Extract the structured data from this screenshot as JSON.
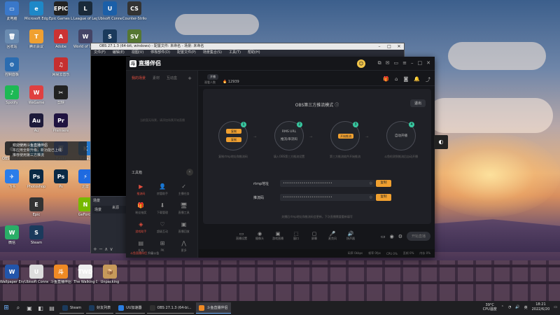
{
  "desktop": {
    "icons": [
      {
        "label": "此电脑",
        "color": "#3a78c9",
        "glyph": "▭"
      },
      {
        "label": "Microsoft Edge",
        "color": "#1e88c8",
        "glyph": "e"
      },
      {
        "label": "Epic Games Launcher",
        "color": "#222222",
        "glyph": "EPIC"
      },
      {
        "label": "League of Legends",
        "color": "#1a2a3a",
        "glyph": "L"
      },
      {
        "label": "Ubisoft Connect",
        "color": "#1b5fa8",
        "glyph": "U"
      },
      {
        "label": "Counter-Strike",
        "color": "#333333",
        "glyph": "CS"
      },
      {
        "label": "回收站",
        "color": "#6a8bb0",
        "glyph": "🗑"
      },
      {
        "label": "腾讯会议",
        "color": "#f0a030",
        "glyph": "T"
      },
      {
        "label": "Adobe",
        "color": "#cc3333",
        "glyph": "A"
      },
      {
        "label": "World of Warships",
        "color": "#444466",
        "glyph": "W"
      },
      {
        "label": "Steam",
        "color": "#1b3a5c",
        "glyph": "S"
      },
      {
        "label": "Stardew Valley",
        "color": "#557733",
        "glyph": "SV"
      },
      {
        "label": "控制面板",
        "color": "#2b6cb0",
        "glyph": "⚙"
      },
      {
        "label": "Au",
        "color": "#1d1a3a",
        "glyph": "Au"
      },
      {
        "label": "剪映",
        "color": "#222222",
        "glyph": "✂"
      },
      {
        "label": "OBS Studio",
        "color": "#303030",
        "glyph": "●"
      },
      {
        "label": "Photoshop",
        "color": "#0a2a45",
        "glyph": "Ps"
      },
      {
        "label": "Premiere",
        "color": "#1f1240",
        "glyph": "Pr"
      },
      {
        "label": "Spotify",
        "color": "#1db954",
        "glyph": "♪"
      },
      {
        "label": "WeGame",
        "color": "#e04040",
        "glyph": "W"
      },
      {
        "label": "网易云音乐",
        "color": "#c62f2f",
        "glyph": "♫"
      },
      {
        "label": "QQ",
        "color": "#1296db",
        "glyph": "Q"
      },
      {
        "label": "Baidu",
        "color": "#2a5bd7",
        "glyph": "百"
      },
      {
        "label": "Kakao",
        "color": "#2277cc",
        "glyph": "K"
      },
      {
        "label": "飞书",
        "color": "#2b7de9",
        "glyph": "✈"
      },
      {
        "label": "Ps",
        "color": "#0a2a45",
        "glyph": "Ps"
      },
      {
        "label": "迅雷",
        "color": "#1e6ae0",
        "glyph": "⚡"
      },
      {
        "label": "Epic",
        "color": "#333333",
        "glyph": "E"
      },
      {
        "label": "微信",
        "color": "#2aae67",
        "glyph": "W"
      },
      {
        "label": "Steam",
        "color": "#1b3a5c",
        "glyph": "S"
      },
      {
        "label": "GeForce",
        "color": "#76b900",
        "glyph": "N"
      },
      {
        "label": "Wallpaper Engine",
        "color": "#2255aa",
        "glyph": "W"
      },
      {
        "label": "Ubisoft Connect",
        "color": "#dddddd",
        "glyph": "U"
      },
      {
        "label": "斗鱼直播伴侣",
        "color": "#f08a24",
        "glyph": "斗"
      },
      {
        "label": "The Walking Dead The",
        "color": "#eeeeee",
        "glyph": "TWD"
      },
      {
        "label": "Unpacking",
        "color": "#c79a5a",
        "glyph": "📦"
      }
    ]
  },
  "tooltip": {
    "line1": "欢迎使用斗鱼直播伴侣",
    "line2": "本应用全新升级，新功能已上线",
    "line3": "推荐使用第三方推流"
  },
  "obs": {
    "title": "OBS 27.1.3 (64-bit, windows) - 配置文件: 未命名 - 场景: 未命名",
    "menu": [
      "文件(F)",
      "编辑(E)",
      "视图(V)",
      "停靠部件(D)",
      "配置文件(P)",
      "场景集合(S)",
      "工具(T)",
      "帮助(H)"
    ],
    "scenes_header": "场景",
    "scene_row": "场景",
    "source_tag": "来源",
    "tool_glyphs": "+ − ∧ ∨"
  },
  "zb": {
    "logo": "直播伴侣",
    "logo_badge": "斗",
    "tabs": [
      "我的场景",
      "素材",
      "互动盒",
      "+"
    ],
    "empty_tip": "当前暂无场景，请添加场景开始直播",
    "tools_title": "工具箱",
    "tools": [
      {
        "label": "推流码",
        "icon": "▶",
        "red": true
      },
      {
        "label": "房管助手",
        "icon": "👤",
        "red": false
      },
      {
        "label": "主播任务",
        "icon": "✓",
        "red": false
      },
      {
        "label": "粉丝抽奖",
        "icon": "🎁",
        "red": false
      },
      {
        "label": "下载管理",
        "icon": "⬇",
        "red": false
      },
      {
        "label": "直播工具",
        "icon": "🖥",
        "red": false
      },
      {
        "label": "游戏助手",
        "icon": "◈",
        "red": true
      },
      {
        "label": "超级互动",
        "icon": "♡",
        "red": false
      },
      {
        "label": "直播回放",
        "icon": "▣",
        "red": false
      },
      {
        "label": "礼物",
        "icon": "▤",
        "red": false
      },
      {
        "label": "PK",
        "icon": "⊞",
        "red": false
      },
      {
        "label": "更多",
        "icon": "⋀",
        "red": false
      }
    ],
    "notice_prefix": "斗鱼直播伴侣",
    "notice_text": "升级公告",
    "header": {
      "pill": "开播",
      "stat_label": "观看人数",
      "stat_value": "12939"
    },
    "mode_title": "OBS第三方推流模式",
    "exit": "退出",
    "steps": [
      {
        "num": "1",
        "chip_top": "复制",
        "chip_bottom": "复制",
        "desc": "复制rtmp地址和推流码"
      },
      {
        "num": "2",
        "line1": "RMS URL",
        "line2": "推流/串流码",
        "desc": "填入OBS第三方推流设置"
      },
      {
        "num": "3",
        "chip": "开始推流",
        "desc": "第三方推流软件开始推流"
      },
      {
        "num": "4",
        "line1": "自动开播",
        "desc": "斗鱼检测到推流后自动开播"
      }
    ],
    "rtmp_label": "rtmp地址",
    "rtmp_value": "••••••••••••••••••••••••",
    "key_label": "推流码",
    "key_value": "••••••••••••••••••••••••",
    "copy": "复制",
    "note": "关播后rtmp地址和推流码会更新，下次直播需要重新填写",
    "bottom_tools": [
      {
        "label": "直播设置",
        "icon": "▭"
      },
      {
        "label": "摄像头",
        "icon": "◉"
      },
      {
        "label": "游戏直播",
        "icon": "▣"
      },
      {
        "label": "窗口",
        "icon": "⬚"
      },
      {
        "label": "屏幕",
        "icon": "▢"
      },
      {
        "label": "麦克风",
        "icon": "🎤"
      },
      {
        "label": "扬声器",
        "icon": "🔊"
      }
    ],
    "start_btn": "开始直播",
    "status": [
      "码率 0kbps",
      "帧率 0fps",
      "CPU 0%",
      "丢帧 0%",
      "内存 0%"
    ]
  },
  "taskbar": {
    "apps": [
      {
        "label": "Steam",
        "color": "#1b3a5c",
        "active": false
      },
      {
        "label": "好友列表",
        "color": "#1b3a5c",
        "active": false
      },
      {
        "label": "UU加速器",
        "color": "#2a7de1",
        "active": false
      },
      {
        "label": "OBS 27.1.3 (64-bi...",
        "color": "#303030",
        "active": false
      },
      {
        "label": "斗鱼直播伴侣",
        "color": "#f08a24",
        "active": true
      }
    ],
    "weather_temp": "39°C",
    "weather_text": "CPU温度",
    "lang": "英",
    "time": "18:21",
    "date": "2022/6/20"
  }
}
